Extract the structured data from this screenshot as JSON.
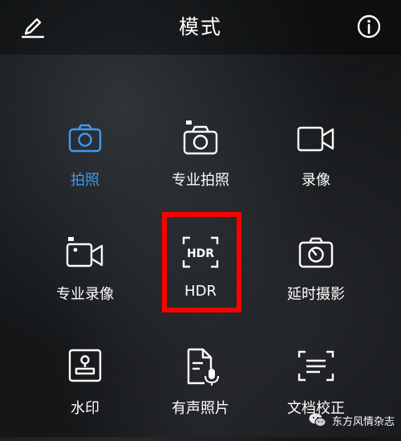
{
  "header": {
    "title": "模式"
  },
  "modes": [
    {
      "label": "拍照",
      "icon": "camera-icon",
      "active": true
    },
    {
      "label": "专业拍照",
      "icon": "pro-camera-icon",
      "active": false
    },
    {
      "label": "录像",
      "icon": "video-icon",
      "active": false
    },
    {
      "label": "专业录像",
      "icon": "pro-video-icon",
      "active": false
    },
    {
      "label": "HDR",
      "icon": "hdr-icon",
      "active": false
    },
    {
      "label": "延时摄影",
      "icon": "timelapse-icon",
      "active": false
    },
    {
      "label": "水印",
      "icon": "watermark-icon",
      "active": false
    },
    {
      "label": "有声照片",
      "icon": "audio-photo-icon",
      "active": false
    },
    {
      "label": "文档校正",
      "icon": "document-correction-icon",
      "active": false
    }
  ],
  "watermark": {
    "text": "东方风情杂志",
    "icon": "wechat-icon"
  },
  "colors": {
    "accent": "#3d9bf2",
    "highlight_frame": "#ff0000",
    "icon": "#ffffff"
  }
}
